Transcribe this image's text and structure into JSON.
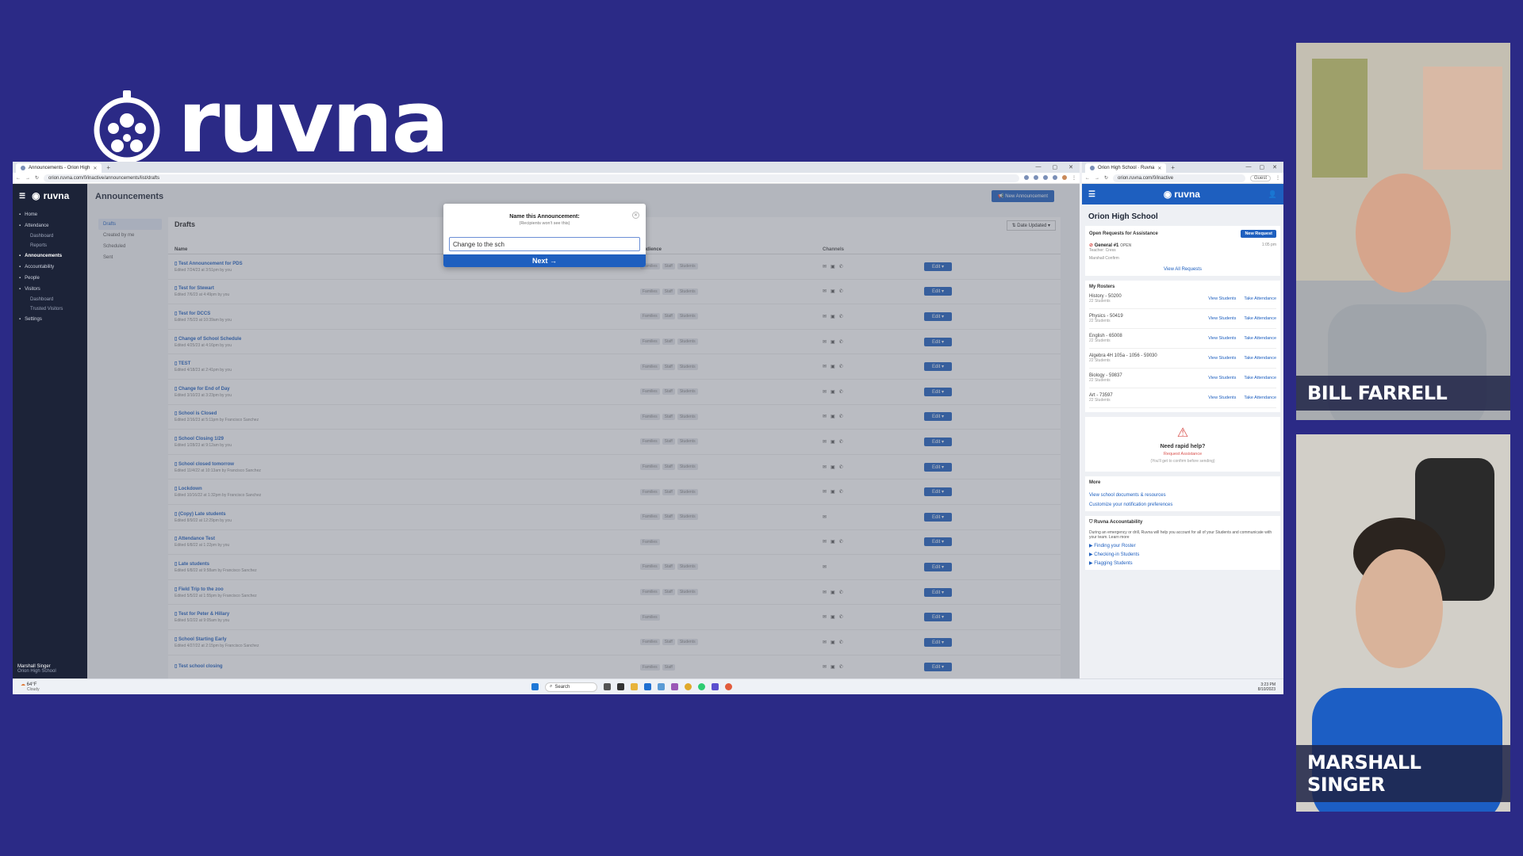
{
  "brand": {
    "wordmark": "ruvna"
  },
  "left_browser": {
    "tab_title": "Announcements - Orion High",
    "url": "orion.ruvna.com/0/inactive/announcements/list/drafts",
    "sidebar": {
      "logo": "ruvna",
      "items": [
        {
          "label": "Home"
        },
        {
          "label": "Attendance"
        },
        {
          "label": "Dashboard",
          "sub": true
        },
        {
          "label": "Reports",
          "sub": true
        },
        {
          "label": "Announcements",
          "active": true
        },
        {
          "label": "Accountability"
        },
        {
          "label": "People"
        },
        {
          "label": "Visitors"
        },
        {
          "label": "Dashboard",
          "sub": true
        },
        {
          "label": "Trusted Visitors",
          "sub": true
        },
        {
          "label": "Settings"
        }
      ],
      "user_name": "Marshall Singer",
      "user_school": "Orion High School"
    },
    "page_title": "Announcements",
    "new_button": "New Announcement",
    "filters": [
      "Drafts",
      "Created by me",
      "Scheduled",
      "Sent"
    ],
    "drafts_title": "Drafts",
    "date_sort": "Date Updated",
    "columns": {
      "name": "Name",
      "audience": "Audience",
      "channels": "Channels"
    },
    "edit_label": "Edit",
    "rows": [
      {
        "title": "Test Announcement for PDS",
        "sub": "Edited 7/24/23 at 3:51pm by you",
        "chips": [
          "Families",
          "Staff",
          "Students"
        ],
        "channels": [
          "✉",
          "▣",
          "✆"
        ]
      },
      {
        "title": "Test for Stewart",
        "sub": "Edited 7/6/23 at 4:49pm by you",
        "chips": [
          "Families",
          "Staff",
          "Students"
        ],
        "channels": [
          "✉",
          "▣",
          "✆"
        ]
      },
      {
        "title": "Test for DCCS",
        "sub": "Edited 7/5/23 at 10:39am by you",
        "chips": [
          "Families",
          "Staff",
          "Students"
        ],
        "channels": [
          "✉",
          "▣",
          "✆"
        ]
      },
      {
        "title": "Change of School Schedule",
        "sub": "Edited 4/25/23 at 4:16pm by you",
        "chips": [
          "Families",
          "Staff",
          "Students"
        ],
        "channels": [
          "✉",
          "▣",
          "✆"
        ]
      },
      {
        "title": "TEST",
        "sub": "Edited 4/18/23 at 2:41pm by you",
        "chips": [
          "Families",
          "Staff",
          "Students"
        ],
        "channels": [
          "✉",
          "▣",
          "✆"
        ]
      },
      {
        "title": "Change for End of Day",
        "sub": "Edited 3/10/23 at 3:23pm by you",
        "chips": [
          "Families",
          "Staff",
          "Students"
        ],
        "channels": [
          "✉",
          "▣",
          "✆"
        ]
      },
      {
        "title": "School is Closed",
        "sub": "Edited 2/16/23 at 5:11pm by Francisco Sanchez",
        "chips": [
          "Families",
          "Staff",
          "Students"
        ],
        "channels": [
          "✉",
          "▣",
          "✆"
        ]
      },
      {
        "title": "School Closing 1/29",
        "sub": "Edited 1/28/23 at 9:12am by you",
        "chips": [
          "Families",
          "Staff",
          "Students"
        ],
        "channels": [
          "✉",
          "▣",
          "✆"
        ]
      },
      {
        "title": "School closed tomorrow",
        "sub": "Edited 11/4/22 at 10:13am by Francisco Sanchez",
        "chips": [
          "Families",
          "Staff",
          "Students"
        ],
        "channels": [
          "✉",
          "▣",
          "✆"
        ]
      },
      {
        "title": "Lockdown",
        "sub": "Edited 10/16/22 at 1:32pm by Francisco Sanchez",
        "chips": [
          "Families",
          "Staff",
          "Students"
        ],
        "channels": [
          "✉",
          "▣",
          "✆"
        ]
      },
      {
        "title": "(Copy) Late students",
        "sub": "Edited 8/9/22 at 12:29pm by you",
        "chips": [
          "Families",
          "Staff",
          "Students"
        ],
        "channels": [
          "✉"
        ]
      },
      {
        "title": "Attendance Test",
        "sub": "Edited 6/8/22 at 1:22pm by you",
        "chips": [
          "Families"
        ],
        "channels": [
          "✉",
          "▣",
          "✆"
        ]
      },
      {
        "title": "Late students",
        "sub": "Edited 6/8/22 at 9:58am by Francisco Sanchez",
        "chips": [
          "Families",
          "Staff",
          "Students"
        ],
        "channels": [
          "✉"
        ]
      },
      {
        "title": "Field Trip to the zoo",
        "sub": "Edited 5/5/22 at 1:55pm by Francisco Sanchez",
        "chips": [
          "Families",
          "Staff",
          "Students"
        ],
        "channels": [
          "✉",
          "▣",
          "✆"
        ]
      },
      {
        "title": "Test for Peter & Hillary",
        "sub": "Edited 5/2/22 at 9:05am by you",
        "chips": [
          "Families"
        ],
        "channels": [
          "✉",
          "▣",
          "✆"
        ]
      },
      {
        "title": "School Starting Early",
        "sub": "Edited 4/27/22 at 2:15pm by Francisco Sanchez",
        "chips": [
          "Families",
          "Staff",
          "Students"
        ],
        "channels": [
          "✉",
          "▣",
          "✆"
        ]
      },
      {
        "title": "Test school closing",
        "sub": "",
        "chips": [
          "Families",
          "Staff"
        ],
        "channels": [
          "✉",
          "▣",
          "✆"
        ]
      }
    ],
    "modal": {
      "title": "Name this Announcement:",
      "subtitle": "(Recipients won't see this)",
      "input_value": "Change to the sch",
      "next_label": "Next →"
    }
  },
  "right_browser": {
    "tab_title": "Orion High School · Ruvna",
    "url": "orion.ruvna.com/0/inactive",
    "guest_label": "Guest",
    "header_logo": "ruvna",
    "school": "Orion High School",
    "requests": {
      "title": "Open Requests for Assistance",
      "new_request": "New Request",
      "item_title": "General #1",
      "item_tag": "OPEN",
      "item_time": "1:05 pm",
      "item_sub1": "Teacher: Cress",
      "item_sub2": "Marshall Confirm",
      "view_all": "View All Requests"
    },
    "rosters_title": "My Rosters",
    "view_students": "View Students",
    "take_attendance": "Take Attendance",
    "rosters": [
      {
        "name": "History - 50200",
        "count": "22 Students"
      },
      {
        "name": "Physics - 50419",
        "count": "22 Students"
      },
      {
        "name": "English - 65008",
        "count": "22 Students"
      },
      {
        "name": "Algebra 4H 105a - 1056 - 59030",
        "count": "22 Students"
      },
      {
        "name": "Biology - 59837",
        "count": "22 Students"
      },
      {
        "name": "Art - 73597",
        "count": "22 Students"
      }
    ],
    "help": {
      "title": "Need rapid help?",
      "action": "Request Assistance",
      "note": "(You'll get to confirm before sending)"
    },
    "more": {
      "title": "More",
      "links": [
        "View school documents & resources",
        "Customize your notification preferences"
      ]
    },
    "accountability": {
      "title": "Ruvna Accountability",
      "body": "During an emergency or drill, Ruvna will help you account for all of your Students and communicate with your team. Learn more",
      "items": [
        "Finding your Roster",
        "Checking-in Students",
        "Flagging Students"
      ]
    }
  },
  "taskbar": {
    "weather_temp": "64°F",
    "weather_desc": "Cloudy",
    "search": "Search",
    "time": "3:23 PM",
    "date": "8/10/2023"
  },
  "webcams": [
    {
      "name": "BILL FARRELL"
    },
    {
      "name": "MARSHALL SINGER"
    }
  ]
}
